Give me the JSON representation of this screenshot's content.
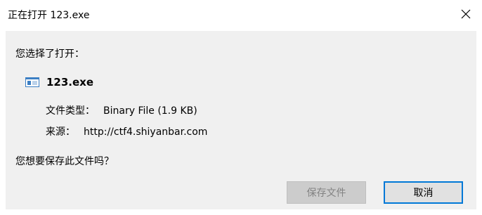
{
  "window": {
    "title": "正在打开 123.exe",
    "close_icon": "close-icon"
  },
  "dialog": {
    "chose_label": "您选择了打开：",
    "file": {
      "icon": "exe-file-icon",
      "name": "123.exe"
    },
    "type_label": "文件类型：",
    "type_value": "Binary File (1.9 KB)",
    "source_label": "来源：",
    "source_value": "http://ctf4.shiyanbar.com",
    "question": "您想要保存此文件吗？"
  },
  "buttons": {
    "save_label": "保存文件",
    "save_disabled": true,
    "cancel_label": "取消"
  },
  "colors": {
    "content_bg": "#f0f0f0",
    "focus_border": "#0078d7",
    "disabled_text": "#838383"
  }
}
